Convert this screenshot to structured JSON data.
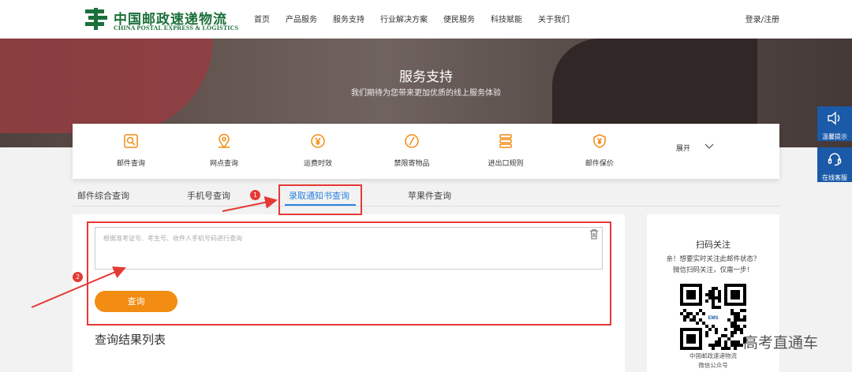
{
  "brand": {
    "name_cn": "中国邮政速递物流",
    "name_en": "CHINA POSTAL EXPRESS & LOGISTICS",
    "color": "#1a6f3a"
  },
  "nav": {
    "items": [
      "首页",
      "产品服务",
      "服务支持",
      "行业解决方案",
      "便民服务",
      "科技赋能",
      "关于我们"
    ],
    "login": "登录/注册"
  },
  "banner": {
    "title": "服务支持",
    "subtitle": "我们期待为您带来更加优质的线上服务体验"
  },
  "services": {
    "items": [
      {
        "label": "邮件查询",
        "icon": "mail-search-icon"
      },
      {
        "label": "网点查询",
        "icon": "location-pin-icon"
      },
      {
        "label": "运费时效",
        "icon": "yen-clock-icon"
      },
      {
        "label": "禁限寄物品",
        "icon": "prohibited-icon"
      },
      {
        "label": "进出口规则",
        "icon": "import-export-icon"
      },
      {
        "label": "邮件保价",
        "icon": "shield-yen-icon"
      }
    ],
    "expand": "展开",
    "accent": "#f28c12"
  },
  "tabs": {
    "items": [
      "邮件综合查询",
      "手机号查询",
      "录取通知书查询",
      "苹果件查询"
    ],
    "active": "录取通知书查询",
    "active_color": "#2a82e4"
  },
  "query": {
    "placeholder": "根据准考证号、考生号、收件人手机号码进行查询",
    "button": "查询",
    "result_title": "查询结果列表"
  },
  "annotations": {
    "badge1": "1",
    "badge2": "2",
    "color": "#e53935"
  },
  "qr": {
    "title": "扫码关注",
    "line1": "亲！想要实时关注此邮件状态？",
    "line2": "微信扫码关注，仅需一步！",
    "caption1": "中国邮政速递物流",
    "caption2": "微信公众号",
    "center_label": "EMS"
  },
  "float_tools": {
    "tip": "温馨提示",
    "service": "在线客服"
  },
  "watermark": "高考直通车"
}
